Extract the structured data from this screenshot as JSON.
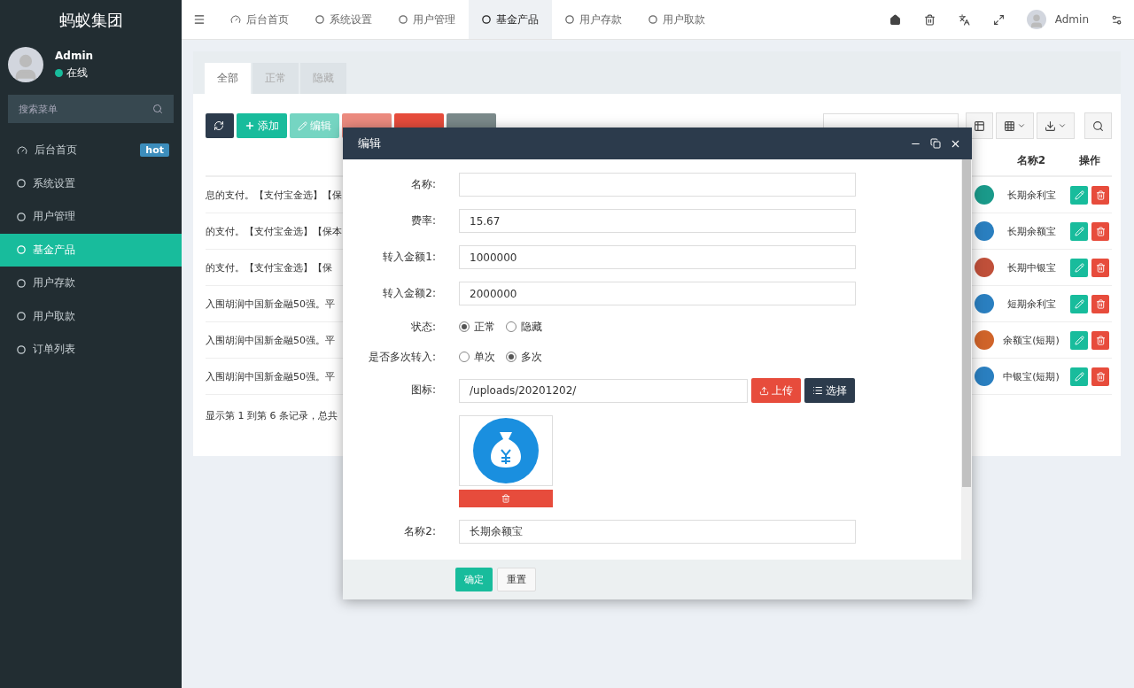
{
  "sidebar": {
    "title": "蚂蚁集团",
    "user": {
      "name": "Admin",
      "status": "在线"
    },
    "search": {
      "placeholder": "搜索菜单"
    },
    "items": [
      {
        "label": "后台首页",
        "kind": "dashboard",
        "badge": "hot",
        "selected": false
      },
      {
        "label": "系统设置",
        "kind": "circle",
        "selected": false
      },
      {
        "label": "用户管理",
        "kind": "circle",
        "selected": false
      },
      {
        "label": "基金产品",
        "kind": "circle",
        "selected": true
      },
      {
        "label": "用户存款",
        "kind": "circle",
        "selected": false
      },
      {
        "label": "用户取款",
        "kind": "circle",
        "selected": false
      },
      {
        "label": "订单列表",
        "kind": "circle",
        "selected": false
      }
    ]
  },
  "navbar": {
    "tabs": [
      {
        "label": "后台首页",
        "kind": "dashboard",
        "selected": false
      },
      {
        "label": "系统设置",
        "kind": "circle",
        "selected": false
      },
      {
        "label": "用户管理",
        "kind": "circle",
        "selected": false
      },
      {
        "label": "基金产品",
        "kind": "circle",
        "selected": true
      },
      {
        "label": "用户存款",
        "kind": "circle",
        "selected": false
      },
      {
        "label": "用户取款",
        "kind": "circle",
        "selected": false
      }
    ],
    "user": {
      "name": "Admin"
    }
  },
  "content_tabs": [
    {
      "label": "全部",
      "selected": true
    },
    {
      "label": "正常",
      "selected": false
    },
    {
      "label": "隐藏",
      "selected": false
    }
  ],
  "toolbar": {
    "buttons": [
      {
        "kind": "refresh"
      },
      {
        "kind": "add",
        "label": "添加"
      },
      {
        "kind": "edit",
        "label": "编辑"
      },
      {
        "kind": "delete"
      },
      {
        "kind": "import"
      },
      {
        "kind": "more"
      }
    ]
  },
  "table": {
    "columns": [
      "名称2",
      "操作"
    ],
    "rows": [
      {
        "description": "息的支付。【支付宝金选】【保",
        "color": "#1a9a8a",
        "name2": "长期余利宝"
      },
      {
        "description": "的支付。【支付宝金选】【保本",
        "color": "#2a7fc0",
        "name2": "长期余额宝"
      },
      {
        "description": "的支付。【支付宝金选】【保",
        "color": "#c0503a",
        "name2": "长期中银宝"
      },
      {
        "description": "入围胡润中国新金融50强。平",
        "color": "#2a7fc0",
        "name2": "短期余利宝"
      },
      {
        "description": "入围胡润中国新金融50强。平",
        "color": "#d0642a",
        "name2": "余额宝(短期)"
      },
      {
        "description": "入围胡润中国新金融50强。平",
        "color": "#2a7fc0",
        "name2": "中银宝(短期)"
      }
    ],
    "footer": "显示第 1 到第 6 条记录，总共"
  },
  "modal": {
    "title": "编辑",
    "fields": [
      {
        "kind": "text",
        "label": "名称:"
      },
      {
        "kind": "text",
        "label": "费率:",
        "value": "15.67"
      },
      {
        "kind": "text",
        "label": "转入金额1:",
        "value": "1000000"
      },
      {
        "kind": "text",
        "label": "转入金额2:",
        "value": "2000000"
      },
      {
        "kind": "radio",
        "label": "状态:",
        "options": [
          {
            "label": "正常",
            "selected": true
          },
          {
            "label": "隐藏",
            "selected": false
          }
        ]
      },
      {
        "kind": "radio",
        "label": "是否多次转入:",
        "options": [
          {
            "label": "单次",
            "selected": false
          },
          {
            "label": "多次",
            "selected": true
          }
        ]
      },
      {
        "kind": "file",
        "label": "图标:",
        "value": "/uploads/20201202/",
        "buttons": [
          "上传",
          "选择"
        ]
      },
      {
        "kind": "text",
        "label": "名称2:",
        "value": "长期余额宝"
      }
    ],
    "buttons": [
      {
        "kind": "primary",
        "label": "确定"
      },
      {
        "kind": "default",
        "label": "重置"
      }
    ]
  }
}
